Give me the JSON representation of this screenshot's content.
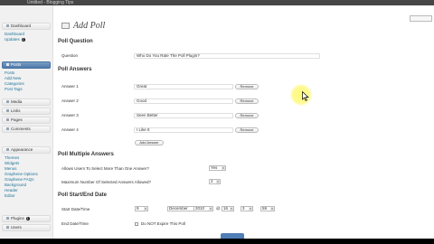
{
  "browser": {
    "tab_title": "Untitled - Blogging Tips"
  },
  "sidebar": {
    "dashboard": {
      "label": "Dashboard",
      "subitems": [
        "Dashboard",
        "Updates"
      ],
      "updates_badge": "1"
    },
    "posts": {
      "label": "Posts",
      "subitems": [
        "Posts",
        "Add New",
        "Categories",
        "Post Tags"
      ]
    },
    "menu": [
      "Media",
      "Links",
      "Pages",
      "Comments"
    ],
    "appearance": {
      "label": "Appearance",
      "subitems": [
        "Themes",
        "Widgets",
        "Menus",
        "Graphene Options",
        "Graphene FAQs",
        "Background",
        "Header",
        "Editor"
      ]
    },
    "plugins": {
      "label": "Plugins",
      "badge": "1"
    },
    "users": {
      "label": "Users"
    }
  },
  "page": {
    "title": "Add Poll"
  },
  "poll_question": {
    "heading": "Poll Question",
    "label": "Question",
    "value": "Who Do You Rate The Poll Plugin?"
  },
  "poll_answers": {
    "heading": "Poll Answers",
    "answers": [
      {
        "label": "Answer 1",
        "value": "Great",
        "remove": "Remove"
      },
      {
        "label": "Answer 2",
        "value": "Good",
        "remove": "Remove"
      },
      {
        "label": "Answer 3",
        "value": "Seen Better",
        "remove": "Remove"
      },
      {
        "label": "Answer 4",
        "value": "I Like It",
        "remove": "Remove"
      }
    ],
    "add_button": "Add Answer"
  },
  "multiple_answers": {
    "heading": "Poll Multiple Answers",
    "allow_label": "Allows Users To Select More Than One Answer?",
    "allow_value": "Yes",
    "max_label": "Maximum Number Of Selected Answers Allowed?",
    "max_value": "2"
  },
  "start_end": {
    "heading": "Poll Start/End Date",
    "start_label": "Start Date/Time",
    "start_day": "9",
    "start_month": "December",
    "start_year": "2010",
    "at": "@",
    "start_hour": "16",
    "start_minute": "3",
    "start_second": "59",
    "end_label": "End Date/Time",
    "end_checkbox_label": "Do NOT Expire This Poll"
  },
  "colors": {
    "sidebar_active": "#4d78a8",
    "link": "#21759b",
    "cursor_highlight": "#fff35a"
  }
}
